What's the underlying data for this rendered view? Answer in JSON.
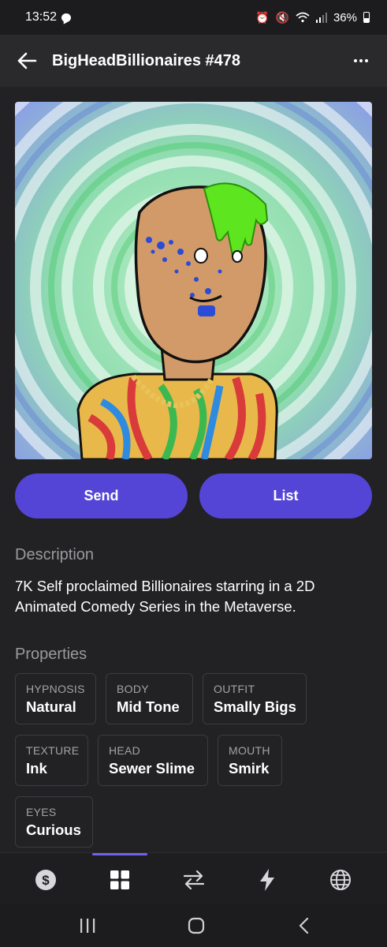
{
  "status_bar": {
    "time": "13:52",
    "battery": "36%"
  },
  "header": {
    "title": "BigHeadBillionaires #478",
    "back_icon": "arrow-left-icon",
    "more_icon": "more-horizontal-icon"
  },
  "actions": {
    "send_label": "Send",
    "list_label": "List",
    "accent_color": "#5545d6"
  },
  "description": {
    "heading": "Description",
    "text": "7K Self proclaimed Billionaires starring in a 2D Animated Comedy Series in the Metaverse."
  },
  "properties": {
    "heading": "Properties",
    "items": [
      {
        "key": "HYPNOSIS",
        "value": "Natural"
      },
      {
        "key": "BODY",
        "value": "Mid Tone"
      },
      {
        "key": "OUTFIT",
        "value": "Smally Bigs"
      },
      {
        "key": "TEXTURE",
        "value": "Ink"
      },
      {
        "key": "HEAD",
        "value": "Sewer Slime"
      },
      {
        "key": "MOUTH",
        "value": "Smirk"
      },
      {
        "key": "EYES",
        "value": "Curious"
      }
    ]
  },
  "bottom_nav": {
    "items": [
      "dollar-icon",
      "grid-icon",
      "swap-icon",
      "lightning-icon",
      "globe-icon"
    ],
    "active": "grid-icon"
  },
  "system_nav": {
    "items": [
      "recents-icon",
      "home-icon",
      "back-icon"
    ]
  }
}
